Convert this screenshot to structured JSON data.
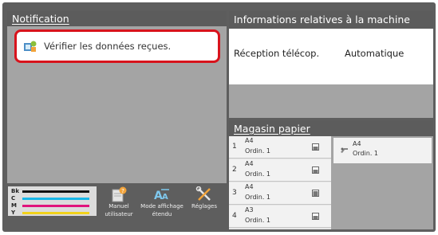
{
  "notification": {
    "title": "Notification",
    "message": "Vérifier les données reçues."
  },
  "machine_info": {
    "title": "Informations relatives à la machine",
    "row_label": "Réception télécop.",
    "row_value": "Automatique"
  },
  "paper_tray": {
    "title": "Magasin papier",
    "trays": [
      {
        "number": "1",
        "size": "A4",
        "type": "Ordin. 1"
      },
      {
        "number": "2",
        "size": "A4",
        "type": "Ordin. 1"
      },
      {
        "number": "3",
        "size": "A4",
        "type": "Ordin. 1"
      },
      {
        "number": "4",
        "size": "A3",
        "type": "Ordin. 1"
      }
    ],
    "bypass": {
      "size": "A4",
      "type": "Ordin. 1"
    }
  },
  "toner": {
    "labels": [
      "Bk",
      "C",
      "M",
      "Y"
    ],
    "colors": [
      "#111111",
      "#19b7e8",
      "#e0147c",
      "#f2d21b"
    ]
  },
  "tools": {
    "manual_line1": "Manuel",
    "manual_line2": "utilisateur",
    "display_line1": "Mode affichage",
    "display_line2": "étendu",
    "settings": "Réglages"
  }
}
